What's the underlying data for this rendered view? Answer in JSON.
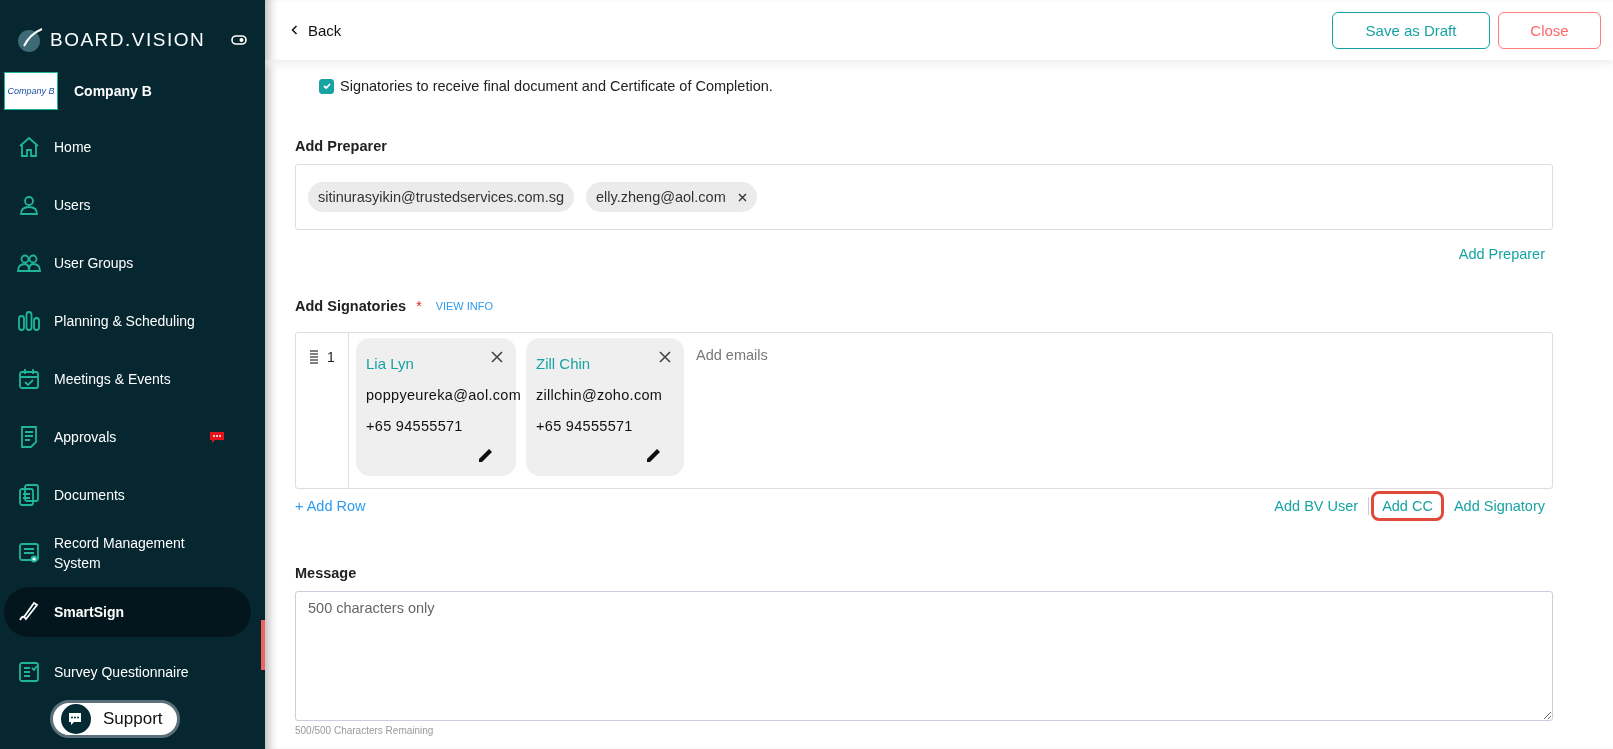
{
  "sidebar": {
    "brand": "BOARD.VISION",
    "company": {
      "logo_text": "Company B",
      "name": "Company B"
    },
    "items": [
      {
        "label": "Home",
        "selected": false,
        "notification": false
      },
      {
        "label": "Users",
        "selected": false,
        "notification": false
      },
      {
        "label": "User Groups",
        "selected": false,
        "notification": false
      },
      {
        "label": "Planning & Scheduling",
        "selected": false,
        "notification": false
      },
      {
        "label": "Meetings & Events",
        "selected": false,
        "notification": false
      },
      {
        "label": "Approvals",
        "selected": false,
        "notification": true
      },
      {
        "label": "Documents",
        "selected": false,
        "notification": false
      },
      {
        "label": "Record Management System",
        "selected": false,
        "notification": false
      },
      {
        "label": "SmartSign",
        "selected": true,
        "notification": false
      },
      {
        "label": "Survey Questionnaire",
        "selected": false,
        "notification": false
      }
    ],
    "support": "Support"
  },
  "header": {
    "back": "Back",
    "buttons": [
      {
        "label": "Save as Draft",
        "kind": "primary"
      },
      {
        "label": "Close",
        "kind": "danger"
      }
    ]
  },
  "certificate_option": {
    "label": "Signatories to receive final document and Certificate of Completion.",
    "checked": true
  },
  "preparer": {
    "label": "Add Preparer",
    "chips": [
      {
        "email": "sitinurasyikin@trustedservices.com.sg",
        "removable": false
      },
      {
        "email": "elly.zheng@aol.com",
        "removable": true
      }
    ],
    "link": "Add Preparer"
  },
  "signatories": {
    "label": "Add Signatories",
    "required": "*",
    "info": "VIEW INFO",
    "rows": [
      {
        "number": "1",
        "cards": [
          {
            "name": "Lia Lyn",
            "email": "poppyeureka@aol.com",
            "phone": "+65 94555571"
          },
          {
            "name": "Zill Chin",
            "email": "zillchin@zoho.com",
            "phone": "+65 94555571"
          }
        ],
        "placeholder": "Add emails"
      }
    ],
    "add_row": "+ Add Row",
    "links": [
      {
        "label": "Add BV User",
        "highlighted": false
      },
      {
        "label": "Add CC",
        "highlighted": true
      },
      {
        "label": "Add Signatory",
        "highlighted": false
      }
    ]
  },
  "message": {
    "label": "Message",
    "placeholder": "500 characters only",
    "counter": "500/500 Characters Remaining"
  }
}
